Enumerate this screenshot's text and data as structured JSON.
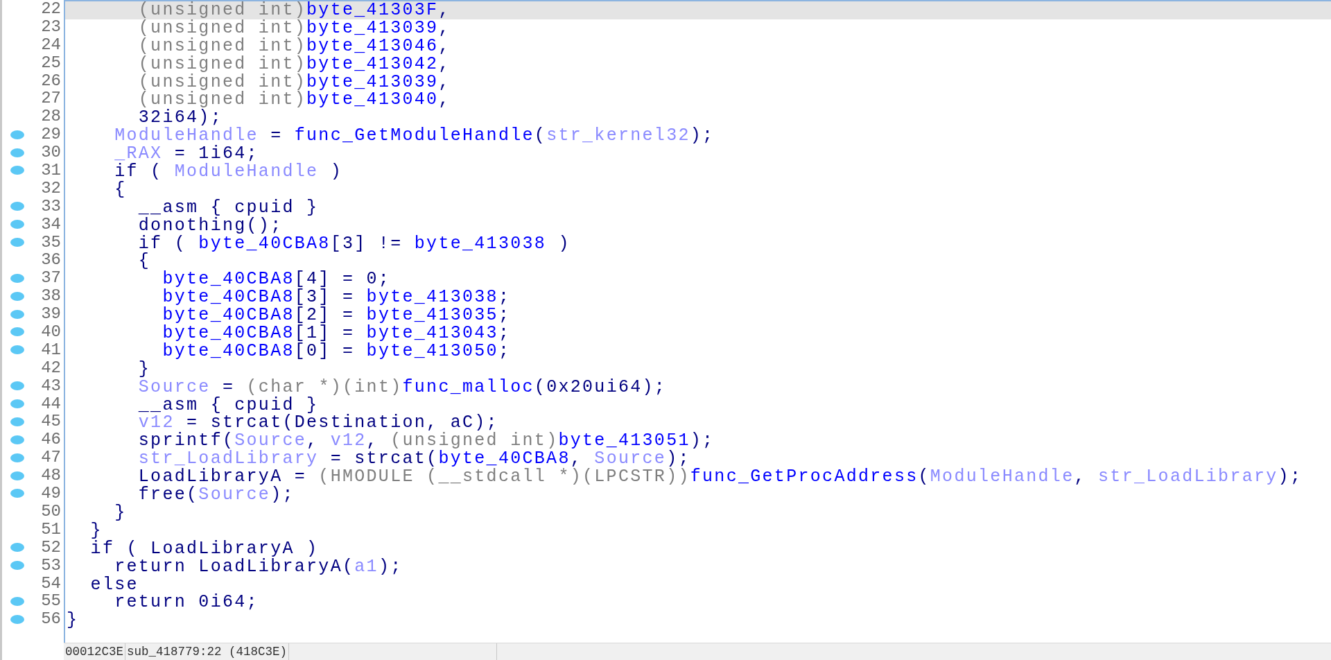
{
  "code_lines": [
    {
      "number": "22",
      "breakpoint": false,
      "highlighted": true,
      "segments": [
        {
          "kind": "type",
          "text": "      (unsigned int)"
        },
        {
          "kind": "global",
          "text": "byte_41303F"
        },
        {
          "kind": "plain",
          "text": ","
        }
      ]
    },
    {
      "number": "23",
      "breakpoint": false,
      "highlighted": false,
      "segments": [
        {
          "kind": "type",
          "text": "      (unsigned int)"
        },
        {
          "kind": "global",
          "text": "byte_413039"
        },
        {
          "kind": "plain",
          "text": ","
        }
      ]
    },
    {
      "number": "24",
      "breakpoint": false,
      "highlighted": false,
      "segments": [
        {
          "kind": "type",
          "text": "      (unsigned int)"
        },
        {
          "kind": "global",
          "text": "byte_413046"
        },
        {
          "kind": "plain",
          "text": ","
        }
      ]
    },
    {
      "number": "25",
      "breakpoint": false,
      "highlighted": false,
      "segments": [
        {
          "kind": "type",
          "text": "      (unsigned int)"
        },
        {
          "kind": "global",
          "text": "byte_413042"
        },
        {
          "kind": "plain",
          "text": ","
        }
      ]
    },
    {
      "number": "26",
      "breakpoint": false,
      "highlighted": false,
      "segments": [
        {
          "kind": "type",
          "text": "      (unsigned int)"
        },
        {
          "kind": "global",
          "text": "byte_413039"
        },
        {
          "kind": "plain",
          "text": ","
        }
      ]
    },
    {
      "number": "27",
      "breakpoint": false,
      "highlighted": false,
      "segments": [
        {
          "kind": "type",
          "text": "      (unsigned int)"
        },
        {
          "kind": "global",
          "text": "byte_413040"
        },
        {
          "kind": "plain",
          "text": ","
        }
      ]
    },
    {
      "number": "28",
      "breakpoint": false,
      "highlighted": false,
      "segments": [
        {
          "kind": "plain",
          "text": "      32i64);"
        }
      ]
    },
    {
      "number": "29",
      "breakpoint": true,
      "highlighted": false,
      "segments": [
        {
          "kind": "local",
          "text": "    ModuleHandle"
        },
        {
          "kind": "plain",
          "text": " = "
        },
        {
          "kind": "global",
          "text": "func_GetModuleHandle"
        },
        {
          "kind": "plain",
          "text": "("
        },
        {
          "kind": "local",
          "text": "str_kernel32"
        },
        {
          "kind": "plain",
          "text": ");"
        }
      ]
    },
    {
      "number": "30",
      "breakpoint": true,
      "highlighted": false,
      "segments": [
        {
          "kind": "local",
          "text": "    _RAX"
        },
        {
          "kind": "plain",
          "text": " = 1i64;"
        }
      ]
    },
    {
      "number": "31",
      "breakpoint": true,
      "highlighted": false,
      "segments": [
        {
          "kind": "plain",
          "text": "    if ( "
        },
        {
          "kind": "local",
          "text": "ModuleHandle"
        },
        {
          "kind": "plain",
          "text": " )"
        }
      ]
    },
    {
      "number": "32",
      "breakpoint": false,
      "highlighted": false,
      "segments": [
        {
          "kind": "plain",
          "text": "    {"
        }
      ]
    },
    {
      "number": "33",
      "breakpoint": true,
      "highlighted": false,
      "segments": [
        {
          "kind": "plain",
          "text": "      __asm { cpuid }"
        }
      ]
    },
    {
      "number": "34",
      "breakpoint": true,
      "highlighted": false,
      "segments": [
        {
          "kind": "plain",
          "text": "      donothing();"
        }
      ]
    },
    {
      "number": "35",
      "breakpoint": true,
      "highlighted": false,
      "segments": [
        {
          "kind": "plain",
          "text": "      if ( "
        },
        {
          "kind": "global",
          "text": "byte_40CBA8"
        },
        {
          "kind": "plain",
          "text": "[3] != "
        },
        {
          "kind": "global",
          "text": "byte_413038"
        },
        {
          "kind": "plain",
          "text": " )"
        }
      ]
    },
    {
      "number": "36",
      "breakpoint": false,
      "highlighted": false,
      "segments": [
        {
          "kind": "plain",
          "text": "      {"
        }
      ]
    },
    {
      "number": "37",
      "breakpoint": true,
      "highlighted": false,
      "segments": [
        {
          "kind": "global",
          "text": "        byte_40CBA8"
        },
        {
          "kind": "plain",
          "text": "[4] = 0;"
        }
      ]
    },
    {
      "number": "38",
      "breakpoint": true,
      "highlighted": false,
      "segments": [
        {
          "kind": "global",
          "text": "        byte_40CBA8"
        },
        {
          "kind": "plain",
          "text": "[3] = "
        },
        {
          "kind": "global",
          "text": "byte_413038"
        },
        {
          "kind": "plain",
          "text": ";"
        }
      ]
    },
    {
      "number": "39",
      "breakpoint": true,
      "highlighted": false,
      "segments": [
        {
          "kind": "global",
          "text": "        byte_40CBA8"
        },
        {
          "kind": "plain",
          "text": "[2] = "
        },
        {
          "kind": "global",
          "text": "byte_413035"
        },
        {
          "kind": "plain",
          "text": ";"
        }
      ]
    },
    {
      "number": "40",
      "breakpoint": true,
      "highlighted": false,
      "segments": [
        {
          "kind": "global",
          "text": "        byte_40CBA8"
        },
        {
          "kind": "plain",
          "text": "[1] = "
        },
        {
          "kind": "global",
          "text": "byte_413043"
        },
        {
          "kind": "plain",
          "text": ";"
        }
      ]
    },
    {
      "number": "41",
      "breakpoint": true,
      "highlighted": false,
      "segments": [
        {
          "kind": "global",
          "text": "        byte_40CBA8"
        },
        {
          "kind": "plain",
          "text": "[0] = "
        },
        {
          "kind": "global",
          "text": "byte_413050"
        },
        {
          "kind": "plain",
          "text": ";"
        }
      ]
    },
    {
      "number": "42",
      "breakpoint": false,
      "highlighted": false,
      "segments": [
        {
          "kind": "plain",
          "text": "      }"
        }
      ]
    },
    {
      "number": "43",
      "breakpoint": true,
      "highlighted": false,
      "segments": [
        {
          "kind": "local",
          "text": "      Source"
        },
        {
          "kind": "plain",
          "text": " = "
        },
        {
          "kind": "type",
          "text": "(char *)(int)"
        },
        {
          "kind": "global",
          "text": "func_malloc"
        },
        {
          "kind": "plain",
          "text": "(0x20ui64);"
        }
      ]
    },
    {
      "number": "44",
      "breakpoint": true,
      "highlighted": false,
      "segments": [
        {
          "kind": "plain",
          "text": "      __asm { cpuid }"
        }
      ]
    },
    {
      "number": "45",
      "breakpoint": true,
      "highlighted": false,
      "segments": [
        {
          "kind": "local",
          "text": "      v12"
        },
        {
          "kind": "plain",
          "text": " = strcat(Destination, aC);"
        }
      ]
    },
    {
      "number": "46",
      "breakpoint": true,
      "highlighted": false,
      "segments": [
        {
          "kind": "plain",
          "text": "      sprintf("
        },
        {
          "kind": "local",
          "text": "Source"
        },
        {
          "kind": "plain",
          "text": ", "
        },
        {
          "kind": "local",
          "text": "v12"
        },
        {
          "kind": "plain",
          "text": ", "
        },
        {
          "kind": "type",
          "text": "(unsigned int)"
        },
        {
          "kind": "global",
          "text": "byte_413051"
        },
        {
          "kind": "plain",
          "text": ");"
        }
      ]
    },
    {
      "number": "47",
      "breakpoint": true,
      "highlighted": false,
      "segments": [
        {
          "kind": "local",
          "text": "      str_LoadLibrary"
        },
        {
          "kind": "plain",
          "text": " = strcat("
        },
        {
          "kind": "global",
          "text": "byte_40CBA8"
        },
        {
          "kind": "plain",
          "text": ", "
        },
        {
          "kind": "local",
          "text": "Source"
        },
        {
          "kind": "plain",
          "text": ");"
        }
      ]
    },
    {
      "number": "48",
      "breakpoint": true,
      "highlighted": false,
      "segments": [
        {
          "kind": "plain",
          "text": "      LoadLibraryA = "
        },
        {
          "kind": "type",
          "text": "(HMODULE (__stdcall *)(LPCSTR))"
        },
        {
          "kind": "global",
          "text": "func_GetProcAddress"
        },
        {
          "kind": "plain",
          "text": "("
        },
        {
          "kind": "local",
          "text": "ModuleHandle"
        },
        {
          "kind": "plain",
          "text": ", "
        },
        {
          "kind": "local",
          "text": "str_LoadLibrary"
        },
        {
          "kind": "plain",
          "text": ");"
        }
      ]
    },
    {
      "number": "49",
      "breakpoint": true,
      "highlighted": false,
      "segments": [
        {
          "kind": "plain",
          "text": "      free("
        },
        {
          "kind": "local",
          "text": "Source"
        },
        {
          "kind": "plain",
          "text": ");"
        }
      ]
    },
    {
      "number": "50",
      "breakpoint": false,
      "highlighted": false,
      "segments": [
        {
          "kind": "plain",
          "text": "    }"
        }
      ]
    },
    {
      "number": "51",
      "breakpoint": false,
      "highlighted": false,
      "segments": [
        {
          "kind": "plain",
          "text": "  }"
        }
      ]
    },
    {
      "number": "52",
      "breakpoint": true,
      "highlighted": false,
      "segments": [
        {
          "kind": "plain",
          "text": "  if ( LoadLibraryA )"
        }
      ]
    },
    {
      "number": "53",
      "breakpoint": true,
      "highlighted": false,
      "segments": [
        {
          "kind": "plain",
          "text": "    return LoadLibraryA("
        },
        {
          "kind": "local",
          "text": "a1"
        },
        {
          "kind": "plain",
          "text": ");"
        }
      ]
    },
    {
      "number": "54",
      "breakpoint": false,
      "highlighted": false,
      "segments": [
        {
          "kind": "plain",
          "text": "  else"
        }
      ]
    },
    {
      "number": "55",
      "breakpoint": true,
      "highlighted": false,
      "segments": [
        {
          "kind": "plain",
          "text": "    return 0i64;"
        }
      ]
    },
    {
      "number": "56",
      "breakpoint": true,
      "highlighted": false,
      "segments": [
        {
          "kind": "plain",
          "text": "}"
        }
      ]
    }
  ],
  "status_bar": {
    "address": "00012C3E",
    "location": "sub_418779:22 (418C3E)"
  }
}
